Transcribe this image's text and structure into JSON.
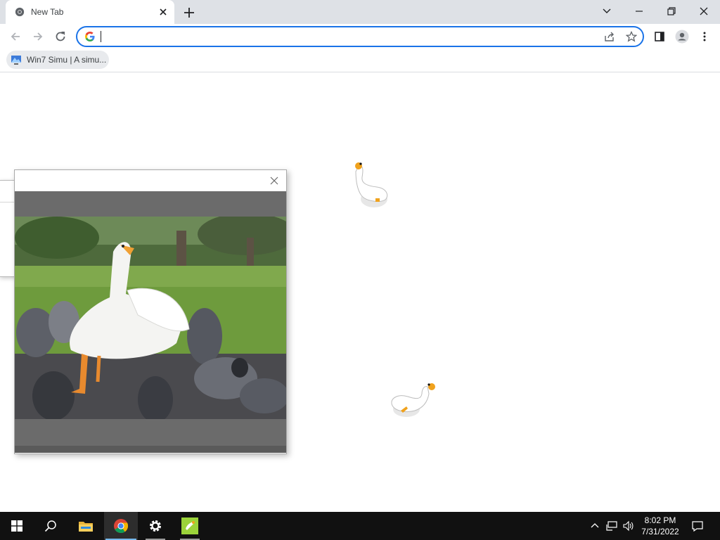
{
  "browser": {
    "tab": {
      "title": "New Tab",
      "favicon": "chrome-logo-icon"
    },
    "omnibox": {
      "value": "",
      "placeholder": ""
    },
    "bookmarks": [
      {
        "label": "Win7 Simu | A simu...",
        "icon": "win7-simu-icon"
      }
    ]
  },
  "desktop": {
    "popup_window": {
      "image": "goose-among-pigeons-photo"
    },
    "geese": [
      "goose-sprite-icon",
      "goose-sprite-icon"
    ]
  },
  "taskbar": {
    "apps": [
      "windows-start-icon",
      "search-icon",
      "file-explorer-icon",
      "chrome-icon",
      "settings-gear-icon",
      "goose-app-icon"
    ],
    "clock": {
      "time": "8:02 PM",
      "date": "7/31/2022"
    }
  },
  "colors": {
    "accent": "#1a73e8",
    "tabstrip": "#dee1e6",
    "taskbar": "#111111",
    "popup_gray": "#6b6b6b",
    "goose_beak": "#f5a623"
  }
}
